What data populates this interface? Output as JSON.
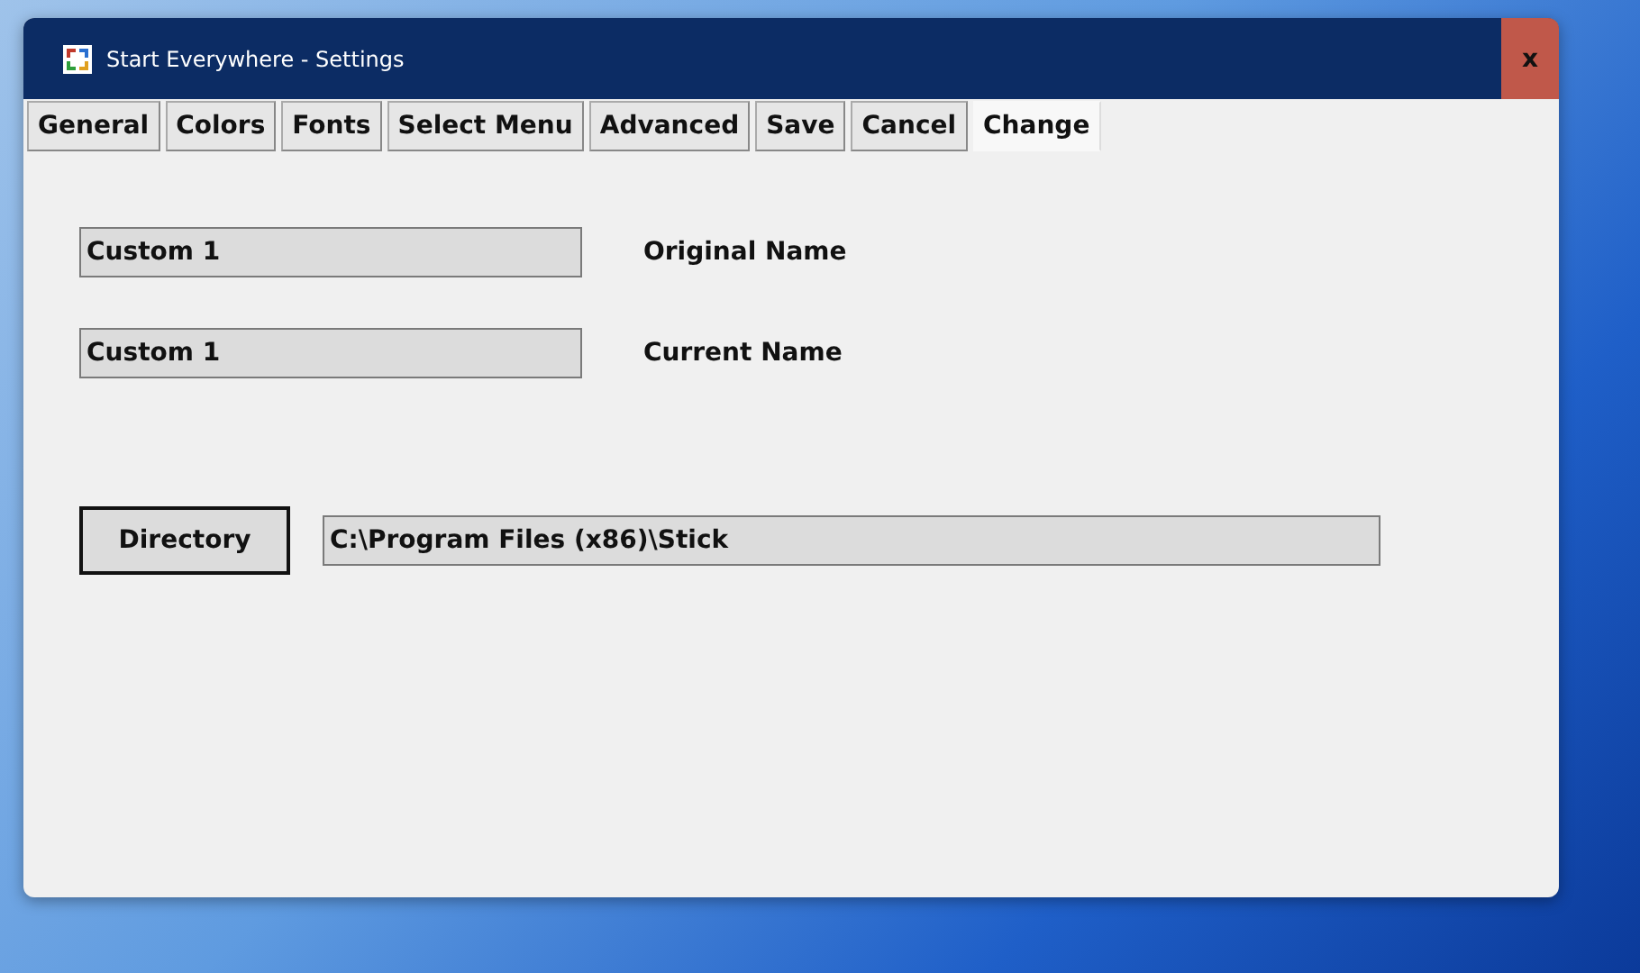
{
  "window": {
    "title": "Start Everywhere - Settings",
    "close": "x"
  },
  "tabs": [
    {
      "label": "General",
      "selected": false
    },
    {
      "label": "Colors",
      "selected": false
    },
    {
      "label": "Fonts",
      "selected": false
    },
    {
      "label": "Select Menu",
      "selected": false
    },
    {
      "label": "Advanced",
      "selected": false
    },
    {
      "label": "Save",
      "selected": false
    },
    {
      "label": "Cancel",
      "selected": false
    },
    {
      "label": "Change",
      "selected": true
    }
  ],
  "fields": [
    {
      "value": "Custom 1",
      "label": "Original Name"
    },
    {
      "value": "Custom 1",
      "label": "Current Name"
    }
  ],
  "directory": {
    "button": "Directory",
    "value": "C:\\Program Files (x86)\\Stick"
  }
}
